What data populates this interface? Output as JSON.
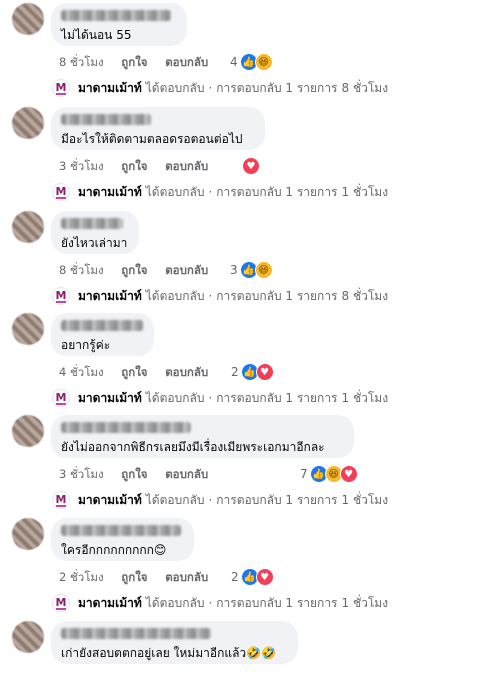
{
  "comments": [
    {
      "text": "ไม่ได้นอน 55",
      "time": "8 ชั่วโมง",
      "like": "ถูกใจ",
      "reply": "ตอบกลับ",
      "reaction_count": "4",
      "reactions": [
        "like-icon",
        "haha-icon"
      ],
      "reply_summary": {
        "page": "มาดามเม้าท์",
        "action": "ได้ตอบกลับ",
        "dot": "·",
        "count_text": "การตอบกลับ 1 รายการ",
        "time": "8 ชั่วโมง"
      }
    },
    {
      "text": "มีอะไรให้ติดตามตลอดรอตอนต่อไป",
      "time": "3 ชั่วโมง",
      "like": "ถูกใจ",
      "reply": "ตอบกลับ",
      "reaction_count": "",
      "reactions": [
        "love-icon"
      ],
      "reply_summary": {
        "page": "มาดามเม้าท์",
        "action": "ได้ตอบกลับ",
        "dot": "·",
        "count_text": "การตอบกลับ 1 รายการ",
        "time": "1 ชั่วโมง"
      }
    },
    {
      "text": "ยังไหวเล่ามา",
      "time": "8 ชั่วโมง",
      "like": "ถูกใจ",
      "reply": "ตอบกลับ",
      "reaction_count": "3",
      "reactions": [
        "like-icon",
        "haha-icon"
      ],
      "reply_summary": {
        "page": "มาดามเม้าท์",
        "action": "ได้ตอบกลับ",
        "dot": "·",
        "count_text": "การตอบกลับ 1 รายการ",
        "time": "8 ชั่วโมง"
      }
    },
    {
      "text": "อยากรู้ค่ะ",
      "time": "4 ชั่วโมง",
      "like": "ถูกใจ",
      "reply": "ตอบกลับ",
      "reaction_count": "2",
      "reactions": [
        "like-icon",
        "love-icon"
      ],
      "reply_summary": {
        "page": "มาดามเม้าท์",
        "action": "ได้ตอบกลับ",
        "dot": "·",
        "count_text": "การตอบกลับ 1 รายการ",
        "time": "1 ชั่วโมง"
      }
    },
    {
      "text": "ยังไม่ออกจากพิธีกรเลยมึงมีเรื่องเมียพระเอกมาอีกละ",
      "time": "3 ชั่วโมง",
      "like": "ถูกใจ",
      "reply": "ตอบกลับ",
      "reaction_count": "7",
      "reactions": [
        "like-icon",
        "haha-icon",
        "love-icon"
      ],
      "reply_summary": {
        "page": "มาดามเม้าท์",
        "action": "ได้ตอบกลับ",
        "dot": "·",
        "count_text": "การตอบกลับ 1 รายการ",
        "time": "1 ชั่วโมง"
      }
    },
    {
      "text": "ใครอีกกกกกกกกก😊",
      "time": "2 ชั่วโมง",
      "like": "ถูกใจ",
      "reply": "ตอบกลับ",
      "reaction_count": "2",
      "reactions": [
        "like-icon",
        "love-icon"
      ],
      "reply_summary": {
        "page": "มาดามเม้าท์",
        "action": "ได้ตอบกลับ",
        "dot": "·",
        "count_text": "การตอบกลับ 1 รายการ",
        "time": "1 ชั่วโมง"
      }
    },
    {
      "text": "เก่ายังสอบตตกอยู่เลย ใหม่มาอีกแล้ว🤣🤣",
      "time": "",
      "like": "",
      "reply": "",
      "reaction_count": "",
      "reactions": [],
      "reply_summary": null
    }
  ],
  "page_avatar_letter": "M",
  "colors": {
    "like": "#1877f2",
    "haha": "#f7b928",
    "love": "#f33e58",
    "bubble": "#f0f2f5"
  }
}
